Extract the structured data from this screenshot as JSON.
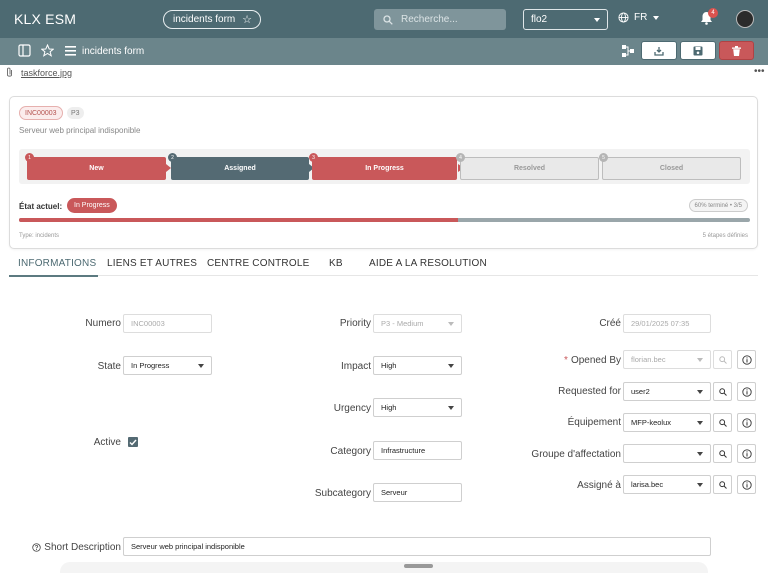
{
  "app": {
    "title": "KLX ESM"
  },
  "topbar": {
    "form_pill": "incidents form",
    "search_placeholder": "Recherche...",
    "user": "flo2",
    "lang": "FR",
    "notif_count": "4"
  },
  "subbar": {
    "title": "incidents form"
  },
  "attachment": {
    "file": "taskforce.jpg"
  },
  "card": {
    "number": "INC00003",
    "priority": "P3",
    "subtitle": "Serveur web principal indisponible",
    "steps": [
      {
        "num": "1",
        "label": "New"
      },
      {
        "num": "2",
        "label": "Assigned"
      },
      {
        "num": "3",
        "label": "In Progress"
      },
      {
        "num": "4",
        "label": "Resolved"
      },
      {
        "num": "5",
        "label": "Closed"
      }
    ],
    "etat_label": "État actuel:",
    "etat_value": "In Progress",
    "progress_text": "60% terminé • 3/5",
    "progress_fraction": 0.6,
    "type_text": "Type: incidents",
    "steps_defined": "5 étapes définies"
  },
  "tabs": [
    {
      "label": "INFORMATIONS"
    },
    {
      "label": "LIENS ET AUTRES"
    },
    {
      "label": "CENTRE CONTROLE"
    },
    {
      "label": "KB"
    },
    {
      "label": "AIDE A LA RESOLUTION"
    }
  ],
  "form": {
    "numero": {
      "label": "Numero",
      "value": "INC00003"
    },
    "state": {
      "label": "State",
      "value": "In Progress"
    },
    "active": {
      "label": "Active",
      "checked": true
    },
    "priority": {
      "label": "Priority",
      "value": "P3 - Medium"
    },
    "impact": {
      "label": "Impact",
      "value": "High"
    },
    "urgency": {
      "label": "Urgency",
      "value": "High"
    },
    "category": {
      "label": "Category",
      "value": "Infrastructure"
    },
    "subcategory": {
      "label": "Subcategory",
      "value": "Serveur"
    },
    "cree": {
      "label": "Créé",
      "value": "29/01/2025 07:35"
    },
    "opened_by": {
      "label": "Opened By",
      "value": "florian.bec"
    },
    "requested_for": {
      "label": "Requested for",
      "value": "user2"
    },
    "equipement": {
      "label": "Équipement",
      "value": "MFP-keolux"
    },
    "groupe": {
      "label": "Groupe d'affectation",
      "value": ""
    },
    "assigne": {
      "label": "Assigné à",
      "value": "larisa.bec"
    },
    "short_desc": {
      "label": "Short Description",
      "value": "Serveur web principal indisponible"
    }
  },
  "colors": {
    "header": "#4d6a72",
    "subbar": "#6b858b",
    "accent_red": "#c9585a",
    "step_dark": "#546a73"
  }
}
